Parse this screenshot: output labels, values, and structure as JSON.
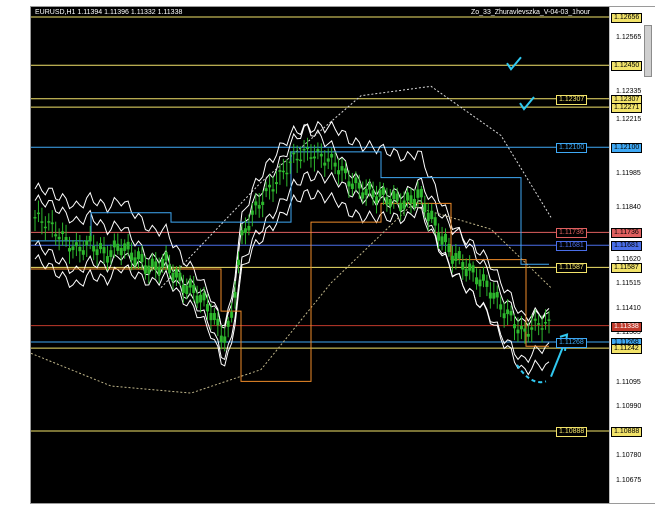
{
  "chart": {
    "title": "EURUSD,H1  1.11394 1.11396 1.11332 1.11338",
    "indicator_label": "Zo_33_Zhuravlevszka_V-04-03_1hour"
  },
  "price_scale": {
    "ticks": [
      "1.12656",
      "1.12565",
      "1.12450",
      "1.12335",
      "1.12271",
      "1.12215",
      "1.12100",
      "1.11985",
      "1.11840",
      "1.11725",
      "1.11620",
      "1.11515",
      "1.11410",
      "1.11305",
      "1.11242",
      "1.11095",
      "1.10990",
      "1.10885",
      "1.10780",
      "1.10675"
    ]
  },
  "levels": [
    {
      "price": "1.12656",
      "color": "#f2e36a",
      "label": "1.12656",
      "tag_in_chart": false
    },
    {
      "price": "1.12450",
      "color": "#f2e36a",
      "label": "1.12450",
      "tag_in_chart": false
    },
    {
      "price": "1.12307",
      "color": "#f2e36a",
      "label": "1.12307",
      "tag_in_chart": true
    },
    {
      "price": "1.12271",
      "color": "#f2e36a",
      "label": "1.12271",
      "tag_in_chart": false
    },
    {
      "price": "1.12100",
      "color": "#3fa9f5",
      "label": "1.12100",
      "tag_in_chart": true
    },
    {
      "price": "1.11736",
      "color": "#e06060",
      "label": "1.11736",
      "tag_in_chart": true
    },
    {
      "price": "1.11681",
      "color": "#4a6ee8",
      "label": "1.11681",
      "tag_in_chart": true
    },
    {
      "price": "1.11587",
      "color": "#f2e36a",
      "label": "1.11587",
      "tag_in_chart": true
    },
    {
      "price": "1.11268",
      "color": "#3fa9f5",
      "label": "1.11268",
      "tag_in_chart": true
    },
    {
      "price": "1.11242",
      "color": "#f2e36a",
      "label": "1.11242",
      "tag_in_chart": false
    },
    {
      "price": "1.10888",
      "color": "#f2e36a",
      "label": "1.10888",
      "tag_in_chart": true
    }
  ],
  "current_price": {
    "value": "1.11338",
    "color": "#c0392b"
  },
  "annotations": {
    "check_icons": 2,
    "arrow_color": "#30c8f0"
  },
  "colors": {
    "candle": "#2db82d",
    "band": "#ffffff",
    "ma_orange": "#f08c2a",
    "ma_blue": "#3fa9f5",
    "level_yellow": "#f2e36a"
  }
}
